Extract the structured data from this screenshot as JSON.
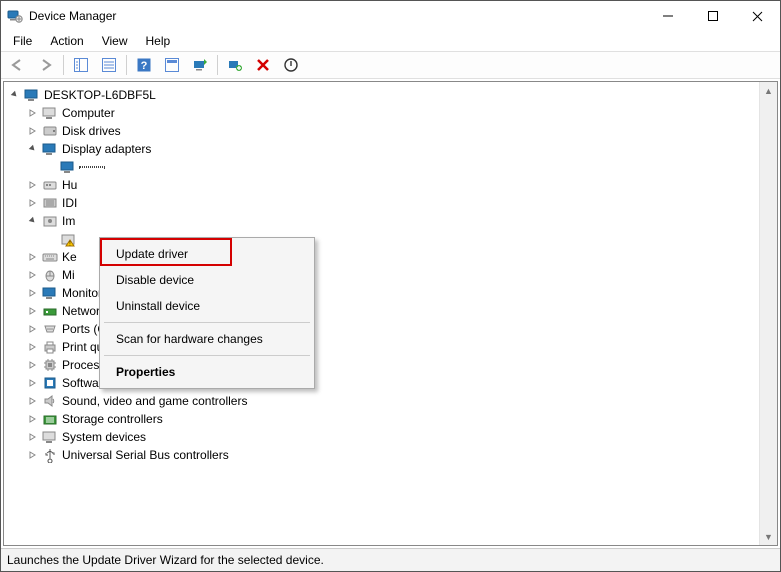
{
  "window": {
    "title": "Device Manager"
  },
  "menu": {
    "file": "File",
    "action": "Action",
    "view": "View",
    "help": "Help"
  },
  "tree": {
    "root": "DESKTOP-L6DBF5L",
    "items": {
      "computer": "Computer",
      "disk_drives": "Disk drives",
      "display_adapters": "Display adapters",
      "hu": "Hu",
      "idi": "IDI",
      "im": "Im",
      "ke": "Ke",
      "mi": "Mi",
      "monitors": "Monitors",
      "network_adapters": "Network adapters",
      "ports": "Ports (COM & LPT)",
      "print_queues": "Print queues",
      "processors": "Processors",
      "software_devices": "Software devices",
      "sound": "Sound, video and game controllers",
      "storage_controllers": "Storage controllers",
      "system_devices": "System devices",
      "usb": "Universal Serial Bus controllers"
    }
  },
  "context_menu": {
    "update_driver": "Update driver",
    "disable_device": "Disable device",
    "uninstall_device": "Uninstall device",
    "scan": "Scan for hardware changes",
    "properties": "Properties"
  },
  "status": "Launches the Update Driver Wizard for the selected device."
}
